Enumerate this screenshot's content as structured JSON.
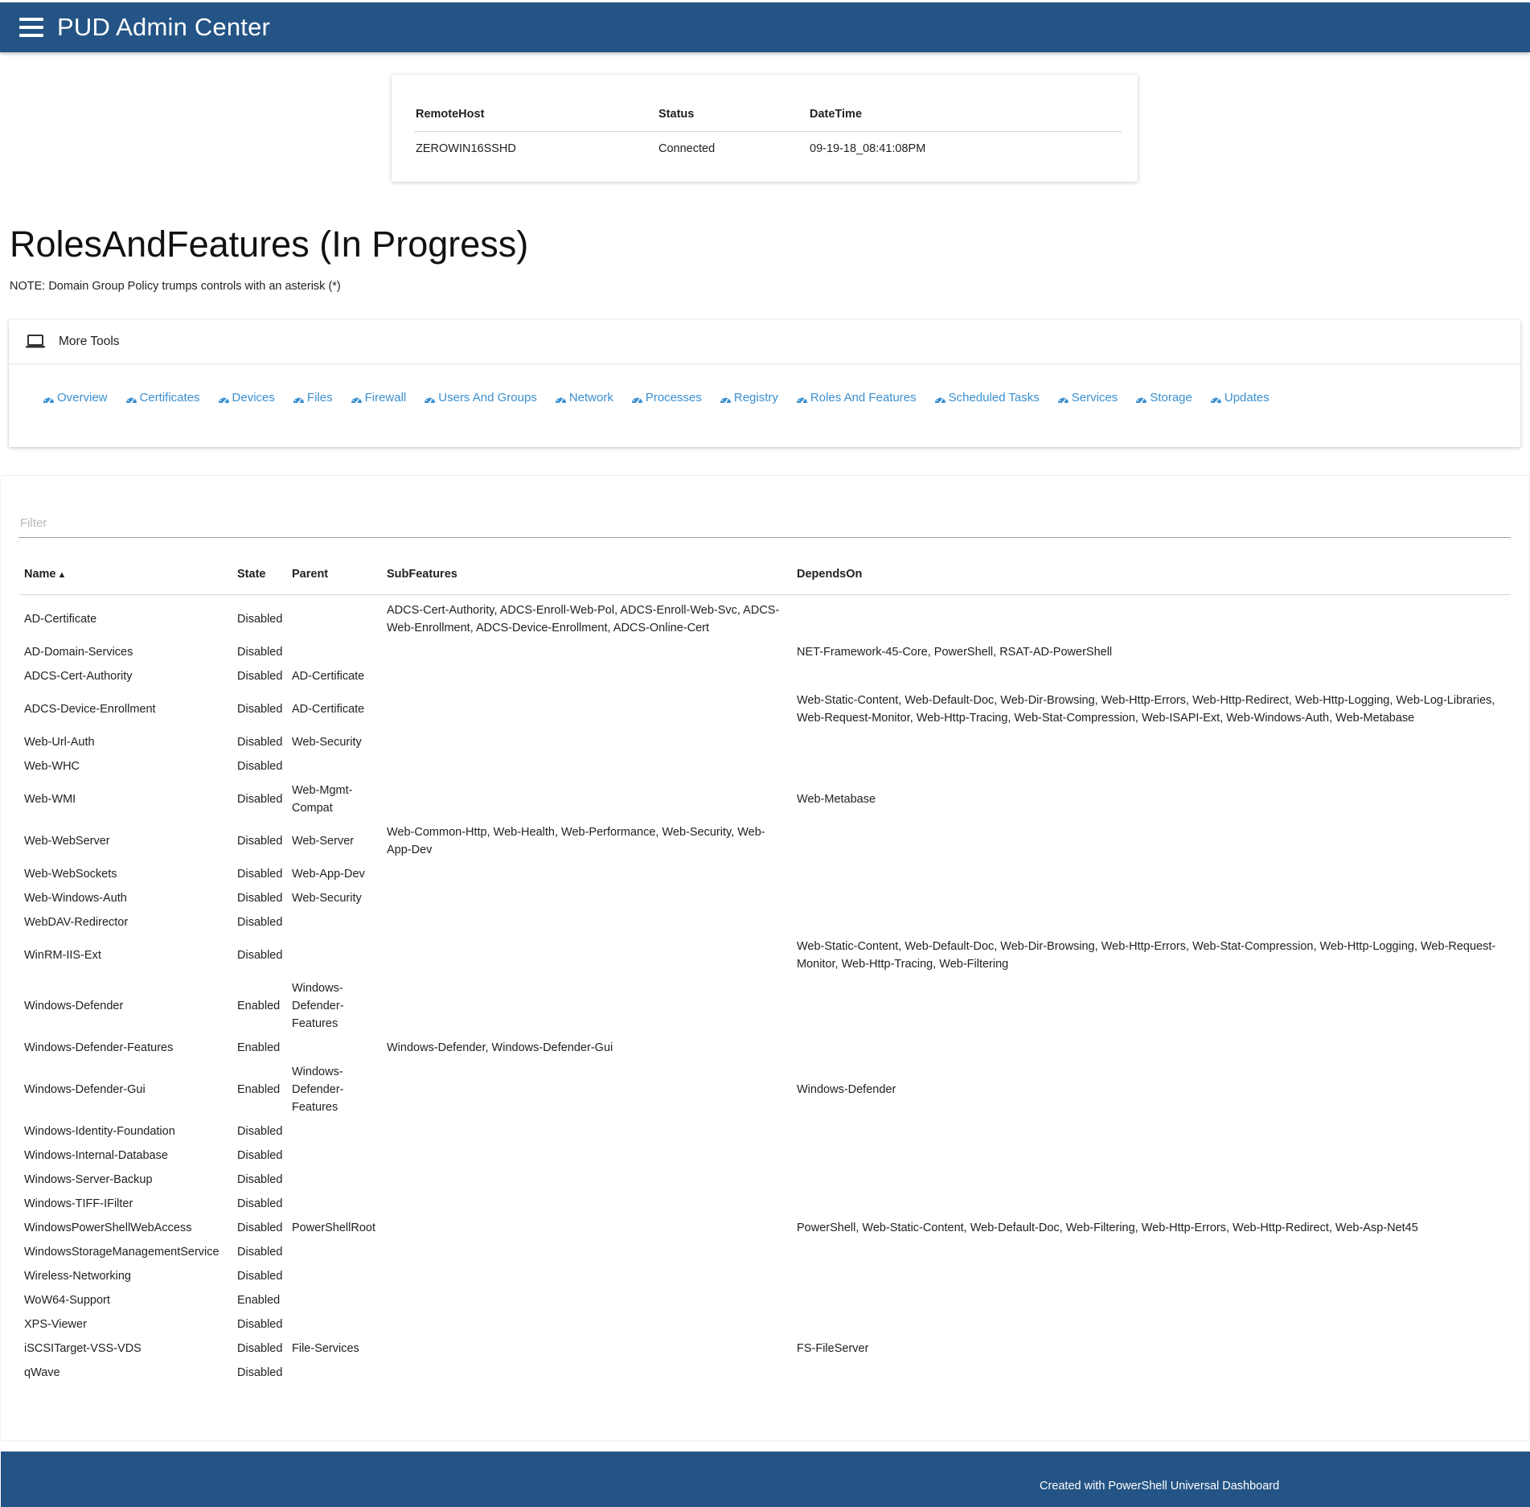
{
  "header": {
    "title": "PUD Admin Center",
    "menu_icon": "hamburger-menu-icon"
  },
  "connection": {
    "columns": [
      "RemoteHost",
      "Status",
      "DateTime"
    ],
    "row": {
      "remote_host": "ZEROWIN16SSHD",
      "status": "Connected",
      "datetime": "09-19-18_08:41:08PM"
    }
  },
  "page": {
    "heading": "RolesAndFeatures (In Progress)",
    "note": "NOTE: Domain Group Policy trumps controls with an asterisk (*)"
  },
  "tools": {
    "title": "More Tools",
    "icon": "laptop-icon",
    "link_icon": "dashboard-icon",
    "link_color": "#3a8fd0",
    "links": [
      "Overview",
      "Certificates",
      "Devices",
      "Files",
      "Firewall",
      "Users And Groups",
      "Network",
      "Processes",
      "Registry",
      "Roles And Features",
      "Scheduled Tasks",
      "Services",
      "Storage",
      "Updates"
    ]
  },
  "features_table": {
    "filter_placeholder": "Filter",
    "filter_value": "",
    "columns": {
      "name": "Name",
      "state": "State",
      "parent": "Parent",
      "subfeatures": "SubFeatures",
      "dependson": "DependsOn"
    },
    "sort_indicator": "▲",
    "rows": [
      {
        "name": "AD-Certificate",
        "state": "Disabled",
        "parent": "",
        "subfeatures": "ADCS-Cert-Authority, ADCS-Enroll-Web-Pol, ADCS-Enroll-Web-Svc, ADCS-Web-Enrollment, ADCS-Device-Enrollment, ADCS-Online-Cert",
        "dependson": ""
      },
      {
        "name": "AD-Domain-Services",
        "state": "Disabled",
        "parent": "",
        "subfeatures": "",
        "dependson": "NET-Framework-45-Core, PowerShell, RSAT-AD-PowerShell"
      },
      {
        "name": "ADCS-Cert-Authority",
        "state": "Disabled",
        "parent": "AD-Certificate",
        "subfeatures": "",
        "dependson": ""
      },
      {
        "name": "ADCS-Device-Enrollment",
        "state": "Disabled",
        "parent": "AD-Certificate",
        "subfeatures": "",
        "dependson": "Web-Static-Content, Web-Default-Doc, Web-Dir-Browsing, Web-Http-Errors, Web-Http-Redirect, Web-Http-Logging, Web-Log-Libraries, Web-Request-Monitor, Web-Http-Tracing, Web-Stat-Compression, Web-ISAPI-Ext, Web-Windows-Auth, Web-Metabase"
      },
      {
        "name": "Web-Url-Auth",
        "state": "Disabled",
        "parent": "Web-Security",
        "subfeatures": "",
        "dependson": ""
      },
      {
        "name": "Web-WHC",
        "state": "Disabled",
        "parent": "",
        "subfeatures": "",
        "dependson": ""
      },
      {
        "name": "Web-WMI",
        "state": "Disabled",
        "parent": "Web-Mgmt-Compat",
        "subfeatures": "",
        "dependson": "Web-Metabase"
      },
      {
        "name": "Web-WebServer",
        "state": "Disabled",
        "parent": "Web-Server",
        "subfeatures": "Web-Common-Http, Web-Health, Web-Performance, Web-Security, Web-App-Dev",
        "dependson": ""
      },
      {
        "name": "Web-WebSockets",
        "state": "Disabled",
        "parent": "Web-App-Dev",
        "subfeatures": "",
        "dependson": ""
      },
      {
        "name": "Web-Windows-Auth",
        "state": "Disabled",
        "parent": "Web-Security",
        "subfeatures": "",
        "dependson": ""
      },
      {
        "name": "WebDAV-Redirector",
        "state": "Disabled",
        "parent": "",
        "subfeatures": "",
        "dependson": ""
      },
      {
        "name": "WinRM-IIS-Ext",
        "state": "Disabled",
        "parent": "",
        "subfeatures": "",
        "dependson": "Web-Static-Content, Web-Default-Doc, Web-Dir-Browsing, Web-Http-Errors, Web-Stat-Compression, Web-Http-Logging, Web-Request-Monitor, Web-Http-Tracing, Web-Filtering"
      },
      {
        "name": "Windows-Defender",
        "state": "Enabled",
        "parent": "Windows-Defender-Features",
        "subfeatures": "",
        "dependson": ""
      },
      {
        "name": "Windows-Defender-Features",
        "state": "Enabled",
        "parent": "",
        "subfeatures": "Windows-Defender, Windows-Defender-Gui",
        "dependson": ""
      },
      {
        "name": "Windows-Defender-Gui",
        "state": "Enabled",
        "parent": "Windows-Defender-Features",
        "subfeatures": "",
        "dependson": "Windows-Defender"
      },
      {
        "name": "Windows-Identity-Foundation",
        "state": "Disabled",
        "parent": "",
        "subfeatures": "",
        "dependson": ""
      },
      {
        "name": "Windows-Internal-Database",
        "state": "Disabled",
        "parent": "",
        "subfeatures": "",
        "dependson": ""
      },
      {
        "name": "Windows-Server-Backup",
        "state": "Disabled",
        "parent": "",
        "subfeatures": "",
        "dependson": ""
      },
      {
        "name": "Windows-TIFF-IFilter",
        "state": "Disabled",
        "parent": "",
        "subfeatures": "",
        "dependson": ""
      },
      {
        "name": "WindowsPowerShellWebAccess",
        "state": "Disabled",
        "parent": "PowerShellRoot",
        "subfeatures": "",
        "dependson": "PowerShell, Web-Static-Content, Web-Default-Doc, Web-Filtering, Web-Http-Errors, Web-Http-Redirect, Web-Asp-Net45"
      },
      {
        "name": "WindowsStorageManagementService",
        "state": "Disabled",
        "parent": "",
        "subfeatures": "",
        "dependson": ""
      },
      {
        "name": "Wireless-Networking",
        "state": "Disabled",
        "parent": "",
        "subfeatures": "",
        "dependson": ""
      },
      {
        "name": "WoW64-Support",
        "state": "Enabled",
        "parent": "",
        "subfeatures": "",
        "dependson": ""
      },
      {
        "name": "XPS-Viewer",
        "state": "Disabled",
        "parent": "",
        "subfeatures": "",
        "dependson": ""
      },
      {
        "name": "iSCSITarget-VSS-VDS",
        "state": "Disabled",
        "parent": "File-Services",
        "subfeatures": "",
        "dependson": "FS-FileServer"
      },
      {
        "name": "qWave",
        "state": "Disabled",
        "parent": "",
        "subfeatures": "",
        "dependson": ""
      }
    ]
  },
  "footer": {
    "text": "Created with PowerShell Universal Dashboard"
  },
  "colors": {
    "header_bg": "#245485",
    "footer_bg": "#245485",
    "link": "#3a8fd0"
  }
}
